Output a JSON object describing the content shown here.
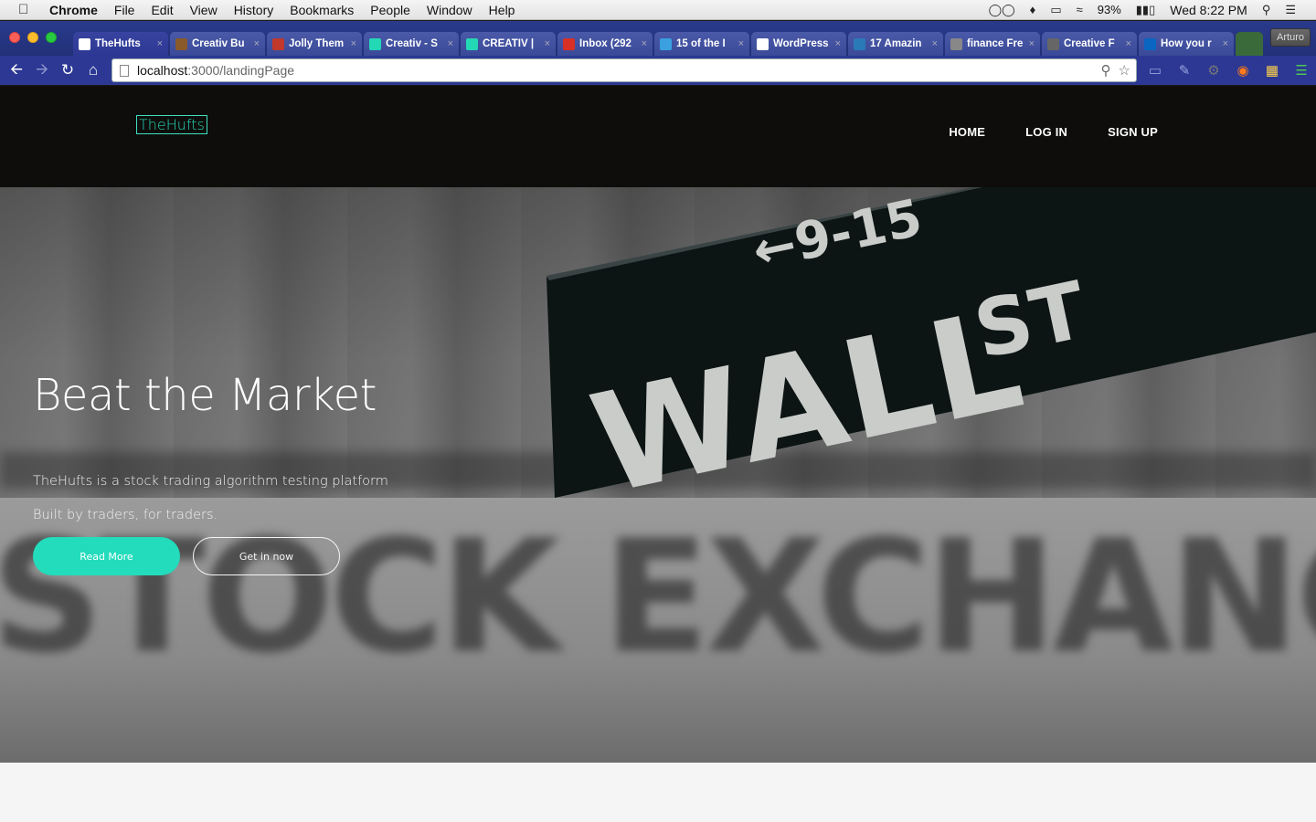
{
  "menubar": {
    "app_name": "Chrome",
    "items": [
      "File",
      "Edit",
      "View",
      "History",
      "Bookmarks",
      "People",
      "Window",
      "Help"
    ],
    "battery": "93%",
    "clock": "Wed 8:22 PM"
  },
  "tabs": [
    {
      "title": "TheHufts",
      "favicon_color": "#ffffff"
    },
    {
      "title": "Creativ Bu",
      "favicon_color": "#8a5a2a"
    },
    {
      "title": "Jolly Them",
      "favicon_color": "#c0392b"
    },
    {
      "title": "Creativ - S",
      "favicon_color": "#23d8b5"
    },
    {
      "title": "CREATIV |",
      "favicon_color": "#23d8b5"
    },
    {
      "title": "Inbox (292",
      "favicon_color": "#d93025"
    },
    {
      "title": "15 of the I",
      "favicon_color": "#3aa0e0"
    },
    {
      "title": "WordPress",
      "favicon_color": "#ffffff"
    },
    {
      "title": "17 Amazin",
      "favicon_color": "#2a7ab8"
    },
    {
      "title": "finance Fre",
      "favicon_color": "#888888"
    },
    {
      "title": "Creative F",
      "favicon_color": "#666666"
    },
    {
      "title": "How you r",
      "favicon_color": "#0a66c2"
    }
  ],
  "profile_name": "Arturo",
  "omnibox": {
    "host": "localhost",
    "path": ":3000/landingPage"
  },
  "site": {
    "logo": "TheHufts",
    "nav": [
      "HOME",
      "LOG IN",
      "SIGN UP"
    ],
    "hero_title": "Beat the Market",
    "hero_sub_1": "TheHufts is a stock trading algorithm testing platform",
    "hero_sub_2": "Built by traders, for traders.",
    "btn_primary": "Read More",
    "btn_secondary": "Get in now"
  },
  "photo_text": {
    "wall": "WALL",
    "st": "ST",
    "numbers": "←9-15",
    "stock": "STOCK",
    "exchange": "EXCHANG"
  },
  "colors": {
    "accent": "#23dcbc",
    "header_bg": "#0e0d0b",
    "chrome_frame": "#2c3894"
  }
}
